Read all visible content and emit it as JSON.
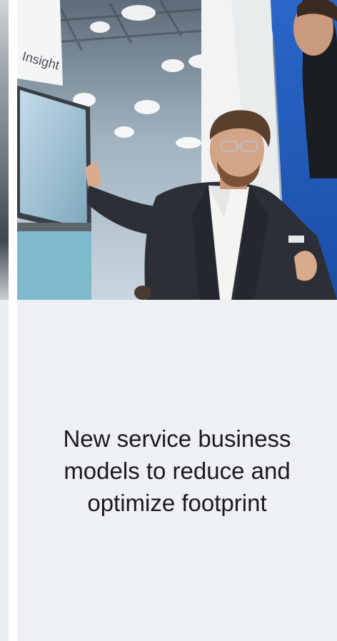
{
  "photo": {
    "display_text": "Insight",
    "alt": "photo"
  },
  "caption": {
    "text": "New service business models to reduce and optimize footprint"
  },
  "colors": {
    "panel_background": "#eef1f4",
    "caption_text": "#1a1a1a",
    "suit": "#2c2f36",
    "shirt": "#f4f4f2",
    "display_frame": "#d9dee3",
    "display_screen": "#8fb7cc"
  },
  "icons": [
    "trade-show-photo"
  ]
}
